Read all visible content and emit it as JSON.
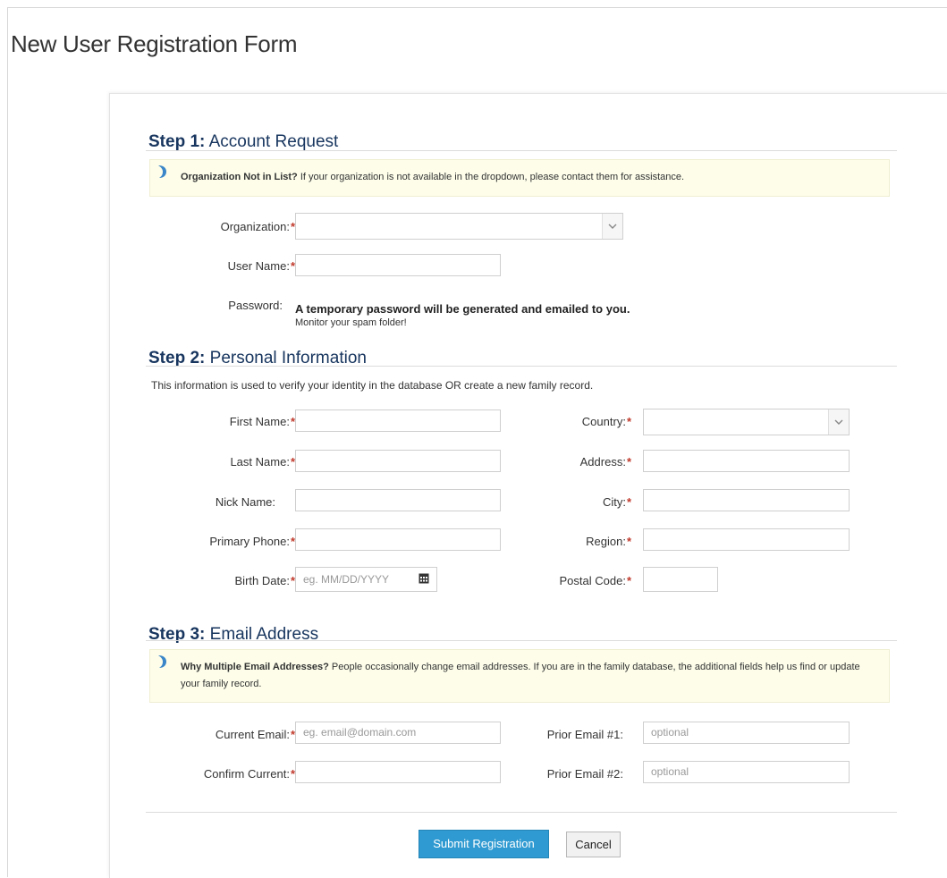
{
  "page": {
    "title": "New User Registration Form"
  },
  "step1": {
    "number": "Step 1:",
    "title": "Account Request",
    "notice": {
      "bold": "Organization Not in List?",
      "text": " If your organization is not available in the dropdown, please contact them for assistance.",
      "icon": "info-icon"
    },
    "organization_label": "Organization:",
    "organization_value": "",
    "username_label": "User Name:",
    "username_value": "",
    "password_label": "Password:",
    "password_main": "A temporary password will be generated and emailed to you.",
    "password_sub": "Monitor your spam folder!"
  },
  "step2": {
    "number": "Step 2:",
    "title": "Personal Information",
    "intro": "This information is used to verify your identity in the database OR create a new family record.",
    "first_name_label": "First Name:",
    "last_name_label": "Last Name:",
    "nick_name_label": "Nick Name:",
    "primary_phone_label": "Primary Phone:",
    "birth_date_label": "Birth Date:",
    "birth_date_placeholder": "eg. MM/DD/YYYY",
    "country_label": "Country:",
    "address_label": "Address:",
    "city_label": "City:",
    "region_label": "Region:",
    "postal_code_label": "Postal Code:"
  },
  "step3": {
    "number": "Step 3:",
    "title": "Email Address",
    "notice": {
      "bold": "Why Multiple Email Addresses?",
      "text": " People occasionally change email addresses. If you are in the family database, the additional fields help us find or update your family record.",
      "icon": "info-icon"
    },
    "current_email_label": "Current Email:",
    "current_email_placeholder": "eg. email@domain.com",
    "confirm_current_label": "Confirm Current:",
    "prior_email1_label": "Prior Email #1:",
    "prior_email1_placeholder": "optional",
    "prior_email2_label": "Prior Email #2:",
    "prior_email2_placeholder": "optional"
  },
  "buttons": {
    "submit": "Submit Registration",
    "cancel": "Cancel"
  },
  "required_marker": "*",
  "colors": {
    "heading": "#17355e",
    "required": "#c0392b",
    "submit_bg": "#2f9ad1",
    "notice_bg": "#fdfdea"
  }
}
